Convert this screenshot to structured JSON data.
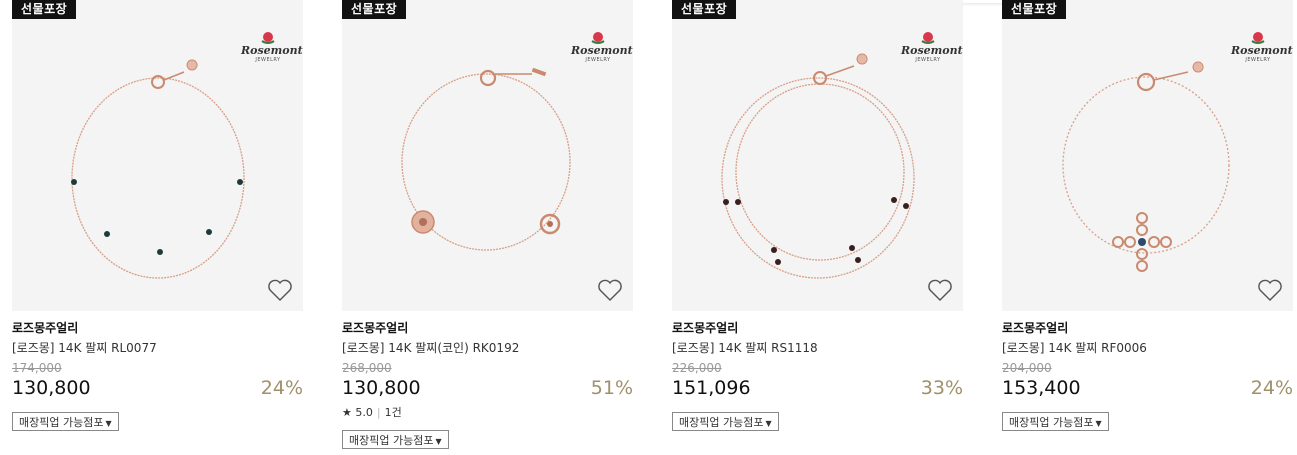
{
  "colors": {
    "discount": "#a0906a",
    "chain": "#d89f88",
    "badge_bg": "#111111"
  },
  "logo": {
    "name": "Rosemont",
    "sub": "JEWELRY"
  },
  "products": [
    {
      "badge": "선물포장",
      "brand": "로즈몽주얼리",
      "name": "[로즈몽] 14K 팔찌 RL0077",
      "original_price": "174,000",
      "price": "130,800",
      "discount": "24%",
      "pickup_label": "매장픽업 가능점포",
      "wishlist_icon": "heart-outline-icon"
    },
    {
      "badge": "선물포장",
      "brand": "로즈몽주얼리",
      "name": "[로즈몽] 14K 팔찌(코인) RK0192",
      "original_price": "268,000",
      "price": "130,800",
      "discount": "51%",
      "rating": "5.0",
      "review_count": "1건",
      "pickup_label": "매장픽업 가능점포",
      "wishlist_icon": "heart-outline-icon"
    },
    {
      "badge": "선물포장",
      "brand": "로즈몽주얼리",
      "name": "[로즈몽] 14K 팔찌 RS1118",
      "original_price": "226,000",
      "price": "151,096",
      "discount": "33%",
      "pickup_label": "매장픽업 가능점포",
      "wishlist_icon": "heart-outline-icon"
    },
    {
      "badge": "선물포장",
      "brand": "로즈몽주얼리",
      "name": "[로즈몽] 14K 팔찌 RF0006",
      "original_price": "204,000",
      "price": "153,400",
      "discount": "24%",
      "pickup_label": "매장픽업 가능점포",
      "wishlist_icon": "heart-outline-icon"
    }
  ]
}
